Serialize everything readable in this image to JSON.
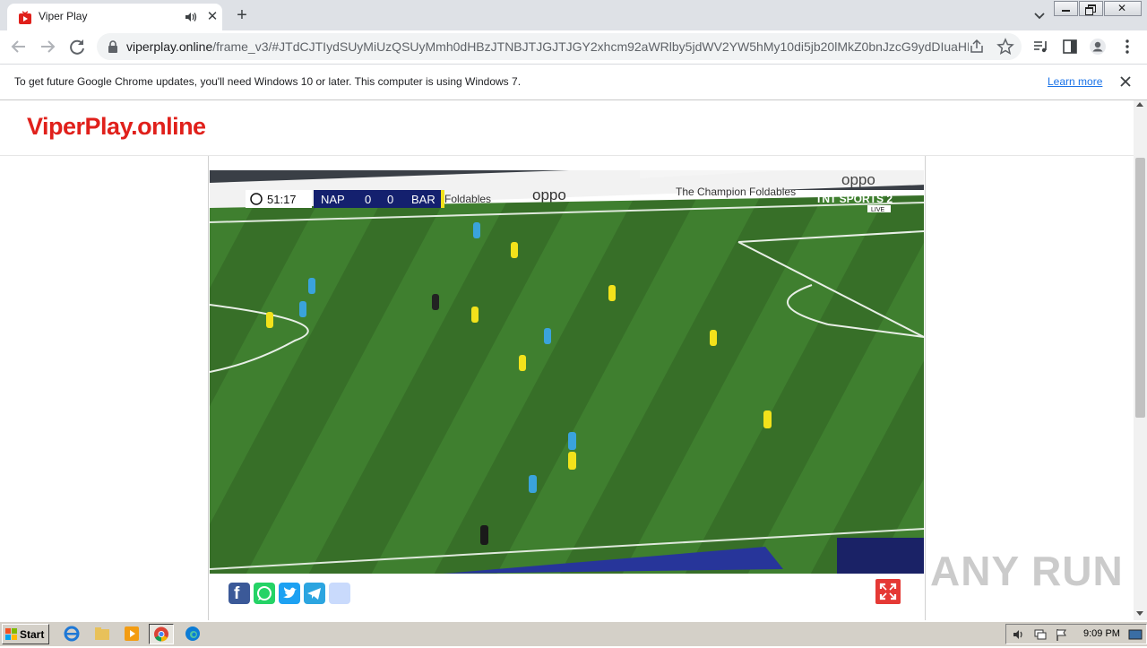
{
  "browser": {
    "tab": {
      "title": "Viper Play"
    },
    "address": {
      "host": "viperplay.online",
      "path": "/frame_v3/#JTdCJTIydSUyMiUzQSUyMmh0dHBzJTNBJTJGJTJGY2xhcm92aWRlby5jdWV2YW5hMy10di5jb20lMkZ0bnJzcG9ydDIuaHR..."
    },
    "infobar": {
      "message": "To get future Google Chrome updates, you'll need Windows 10 or later. This computer is using Windows 7.",
      "link": "Learn more"
    }
  },
  "site": {
    "logo": "ViperPlay.online"
  },
  "video": {
    "clock": "51:17",
    "home_team": "NAP",
    "away_team": "BAR",
    "home_score": "0",
    "away_score": "0",
    "channel": "TNT SPORTS 2",
    "live_badge": "LIVE",
    "ad_1": "oppo",
    "ad_2": "The Champion Foldables",
    "ad_3": "Foldables"
  },
  "share": [
    "facebook",
    "whatsapp",
    "twitter",
    "telegram",
    "share"
  ],
  "watermark": "ANY RUN",
  "taskbar": {
    "start": "Start",
    "clock": "9:09 PM"
  },
  "colors": {
    "logo": "#e0201b",
    "facebook": "#3b5998",
    "whatsapp": "#25d366",
    "twitter": "#1da1f2",
    "telegram": "#2ca5e0",
    "fullscreen": "#e53935",
    "pitch": "#3c7a2c"
  }
}
